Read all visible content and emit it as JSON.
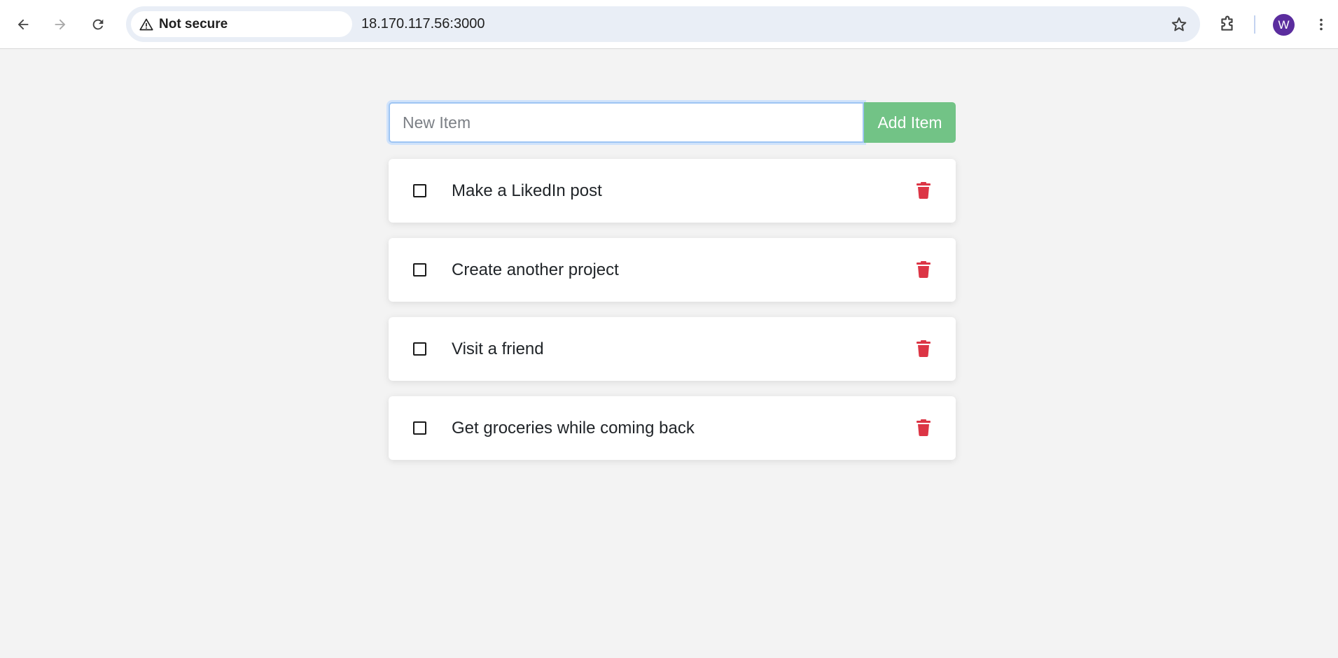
{
  "browser": {
    "security_label": "Not secure",
    "url": "18.170.117.56:3000",
    "profile_initial": "W",
    "icons": [
      "back-arrow-icon",
      "forward-arrow-icon",
      "reload-icon",
      "warning-icon",
      "star-icon",
      "extensions-icon",
      "more-vert-icon"
    ]
  },
  "todo": {
    "input_placeholder": "New Item",
    "add_button_label": "Add Item",
    "items": [
      {
        "text": "Make a LikedIn post",
        "done": false
      },
      {
        "text": "Create another project",
        "done": false
      },
      {
        "text": "Visit a friend",
        "done": false
      },
      {
        "text": "Get groceries while coming back",
        "done": false
      }
    ]
  },
  "colors": {
    "add_button": "#72c386",
    "trash_icon": "#dc3545",
    "page_background": "#f3f3f3",
    "avatar": "#5b2d9e"
  }
}
